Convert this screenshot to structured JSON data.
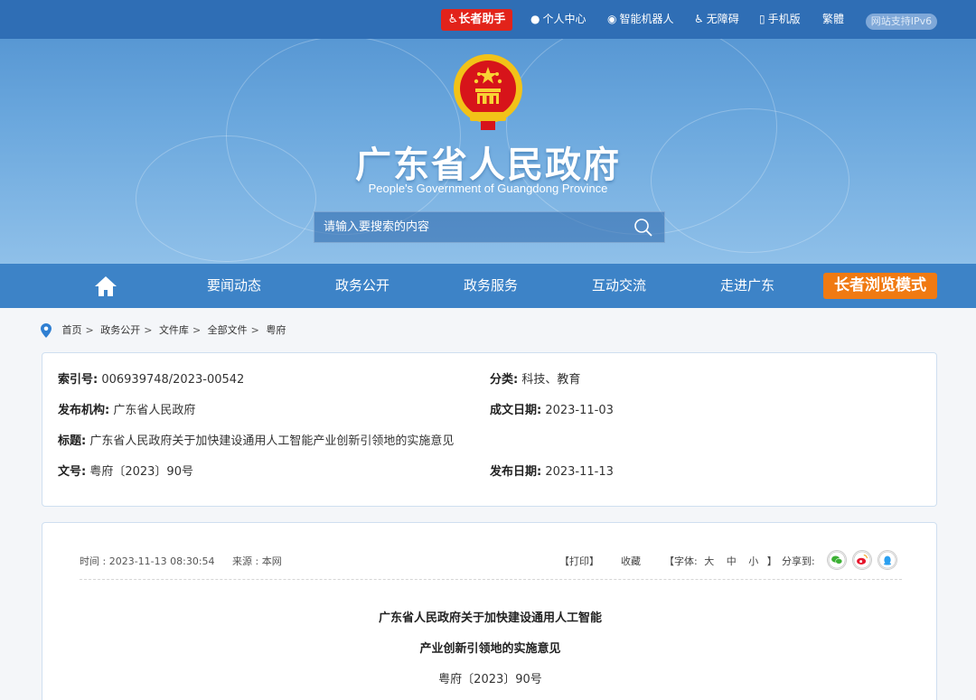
{
  "topbar": {
    "elder_assistant": "长者助手",
    "personal_center": "个人中心",
    "robot": "智能机器人",
    "accessibility": "无障碍",
    "mobile": "手机版",
    "traditional": "繁體",
    "ipv6": "网站支持IPv6"
  },
  "header": {
    "title": "广东省人民政府",
    "subtitle": "People's Government of Guangdong Province",
    "search_placeholder": "请输入要搜索的内容"
  },
  "nav": {
    "items": [
      "要闻动态",
      "政务公开",
      "政务服务",
      "互动交流",
      "走进广东"
    ],
    "elder_mode": "长者浏览模式"
  },
  "breadcrumb": [
    "首页",
    "政务公开",
    "文件库",
    "全部文件",
    "粤府"
  ],
  "info": {
    "index_label": "索引号:",
    "index_value": "006939748/2023-00542",
    "category_label": "分类:",
    "category_value": "科技、教育",
    "publisher_label": "发布机构:",
    "publisher_value": "广东省人民政府",
    "written_label": "成文日期:",
    "written_value": "2023-11-03",
    "title_label": "标题:",
    "title_value": "广东省人民政府关于加快建设通用人工智能产业创新引领地的实施意见",
    "docno_label": "文号:",
    "docno_value": "粤府〔2023〕90号",
    "published_label": "发布日期:",
    "published_value": "2023-11-13"
  },
  "article": {
    "time": "时间 : 2023-11-13 08:30:54",
    "source": "来源 : 本网",
    "print": "【打印】",
    "favorite": "收藏",
    "font_prefix": "【字体:",
    "font_large": "大",
    "font_medium": "中",
    "font_small": "小",
    "font_suffix": "】",
    "share_label": "分享到:",
    "title_line1": "广东省人民政府关于加快建设通用人工智能",
    "title_line2": "产业创新引领地的实施意见",
    "doc_number": "粤府〔2023〕90号"
  },
  "colors": {
    "topbar": "#2f6eb5",
    "nav": "#3d83c7",
    "elder_red": "#e2231a",
    "elder_orange": "#f07a12"
  }
}
